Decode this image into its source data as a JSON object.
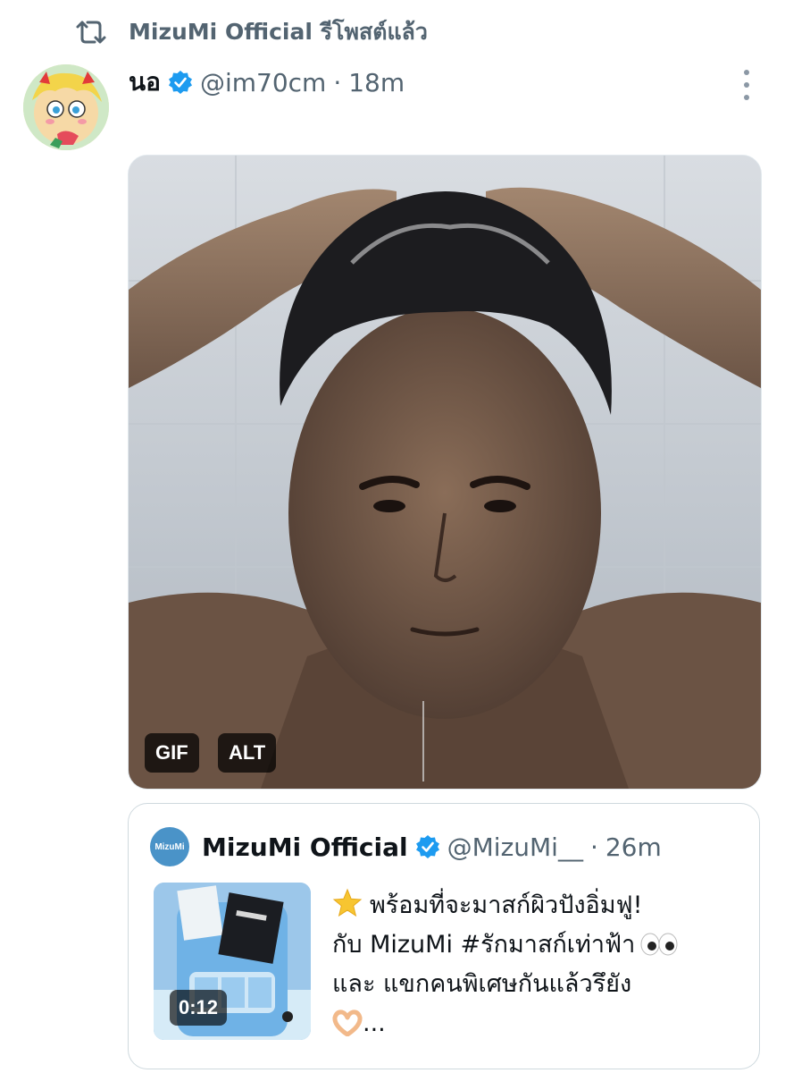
{
  "repost": {
    "label": "MizuMi Official รีโพสต์แล้ว"
  },
  "post": {
    "display_name": "นอ",
    "handle": "@im70cm",
    "separator": "·",
    "time": "18m",
    "media": {
      "gif_label": "GIF",
      "alt_label": "ALT"
    }
  },
  "quote": {
    "logo_text": "MizuMi",
    "display_name": "MizuMi Official",
    "handle": "@MizuMi__",
    "separator": "·",
    "time": "26m",
    "duration": "0:12",
    "lines": [
      "พร้อมที่จะมาสก์ผิวปังอิ่มฟู!",
      "กับ MizuMi #รักมาสก์เท่าฟ้า",
      "และ แขกคนพิเศษกันแล้วรึยัง",
      "..."
    ]
  },
  "icons": {
    "repost": "repost-icon",
    "verified": "verified-badge-icon",
    "more": "more-options-icon",
    "star": "star-emoji-icon",
    "eyes": "eyes-emoji-icon",
    "heart_hands": "heart-hands-emoji-icon"
  },
  "colors": {
    "verified": "#1d9bf0",
    "secondary_text": "#536471",
    "brand": "#4a93c8"
  }
}
